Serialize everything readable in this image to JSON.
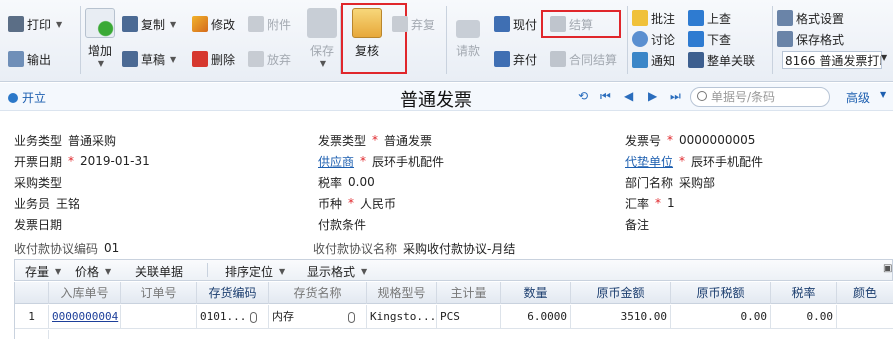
{
  "toolbar": {
    "print": "打印",
    "export": "输出",
    "add": "增加",
    "copy": "复制",
    "draft": "草稿",
    "modify": "修改",
    "delete": "删除",
    "attach": "附件",
    "discard": "放弃",
    "save": "保存",
    "review": "复核",
    "abandon_review": "弃复",
    "request_payment": "请款",
    "cash_pay": "现付",
    "abandon_pay": "弃付",
    "settle": "结算",
    "contract_settle": "合同结算",
    "approve_comment": "批注",
    "discuss": "讨论",
    "notify": "通知",
    "prev_query": "上查",
    "next_query": "下查",
    "whole_link": "整单关联",
    "format_settings": "格式设置",
    "save_format": "保存格式",
    "print_template": "8166 普通发票打印"
  },
  "titlebar": {
    "open": "开立",
    "title": "普通发票",
    "search_placeholder": "单据号/条码",
    "advanced": "高级"
  },
  "form": {
    "business_type_label": "业务类型",
    "business_type": "普通采购",
    "invoice_type_label": "发票类型",
    "invoice_type": "普通发票",
    "invoice_no_label": "发票号",
    "invoice_no": "0000000005",
    "invoice_date_label": "开票日期",
    "invoice_date": "2019-01-31",
    "supplier_label": "供应商",
    "supplier": "辰环手机配件",
    "agent_label": "代垫单位",
    "agent": "辰环手机配件",
    "purchase_type_label": "采购类型",
    "tax_rate_label": "税率",
    "tax_rate": "0.00",
    "dept_label": "部门名称",
    "dept": "采购部",
    "clerk_label": "业务员",
    "clerk": "王铭",
    "currency_label": "币种",
    "currency": "人民币",
    "exchange_label": "汇率",
    "exchange": "1",
    "bill_date_label": "发票日期",
    "pay_terms_label": "付款条件",
    "remark_label": "备注",
    "protocol_code_label": "收付款协议编码",
    "protocol_code": "01",
    "protocol_name_label": "收付款协议名称",
    "protocol_name": "采购收付款协议-月结"
  },
  "grid_toolbar": {
    "stock": "存量",
    "price": "价格",
    "linked_docs": "关联单据",
    "sort": "排序定位",
    "display": "显示格式"
  },
  "grid": {
    "headers": [
      "入库单号",
      "订单号",
      "存货编码",
      "存货名称",
      "规格型号",
      "主计量",
      "数量",
      "原币金额",
      "原币税额",
      "税率",
      "颜色"
    ],
    "rows": [
      {
        "idx": "1",
        "receipt_no": "0000000004",
        "order_no": "",
        "code": "0101...",
        "name": "内存",
        "spec": "Kingsto...",
        "unit": "PCS",
        "qty": "6.0000",
        "amount": "3510.00",
        "tax": "0.00",
        "rate": "0.00",
        "color": ""
      }
    ]
  }
}
